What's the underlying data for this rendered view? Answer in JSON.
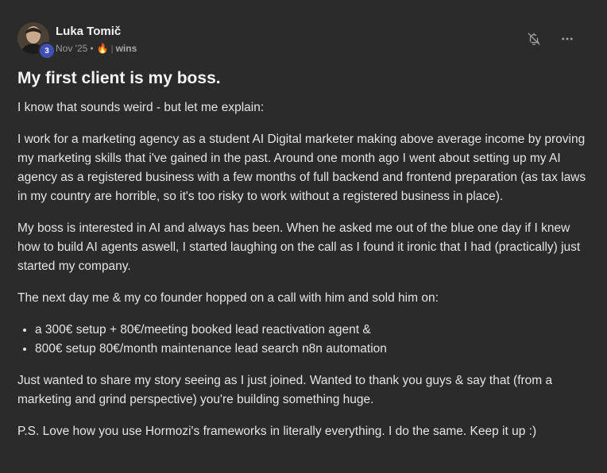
{
  "author": {
    "name": "Luka Tomič",
    "level": "3",
    "date": "Nov '25",
    "dot": "•",
    "fire": "🔥",
    "separator": "|",
    "category": "wins"
  },
  "actions": {
    "mute_icon": "bell-slash-icon",
    "more_icon": "more-horizontal-icon"
  },
  "post": {
    "title": "My first client is my boss.",
    "paragraphs": [
      "I know that sounds weird - but let me explain:",
      "I work for a marketing agency as a student AI Digital marketer making above average income by proving my marketing skills that i've gained in the past. Around one month ago I went about setting up my AI agency as a registered business with a few months of full backend and frontend preparation (as tax laws in my country are horrible, so it's too risky to work without a registered business in place).",
      "My boss is interested in AI and always has been. When he asked me out of the blue one day if I knew how to build AI agents aswell, I started laughing on the call as I found it ironic that I had (practically) just started my company.",
      "The next day me & my co founder hopped on a call with him and sold him on:"
    ],
    "bullets": [
      "a 300€ setup + 80€/meeting booked lead reactivation agent &",
      "800€ setup 80€/month maintenance lead search n8n automation"
    ],
    "closing": [
      "Just wanted to share my story seeing as I just joined. Wanted to thank you guys & say that (from a marketing and grind perspective) you're building something huge.",
      "P.S. Love how you use Hormozi's frameworks in literally everything. I do the same. Keep it up :)"
    ]
  },
  "colors": {
    "background": "#2b2b2b",
    "badge": "#3f51b5",
    "text": "#e4e4e4",
    "muted": "#9a9a9a"
  }
}
